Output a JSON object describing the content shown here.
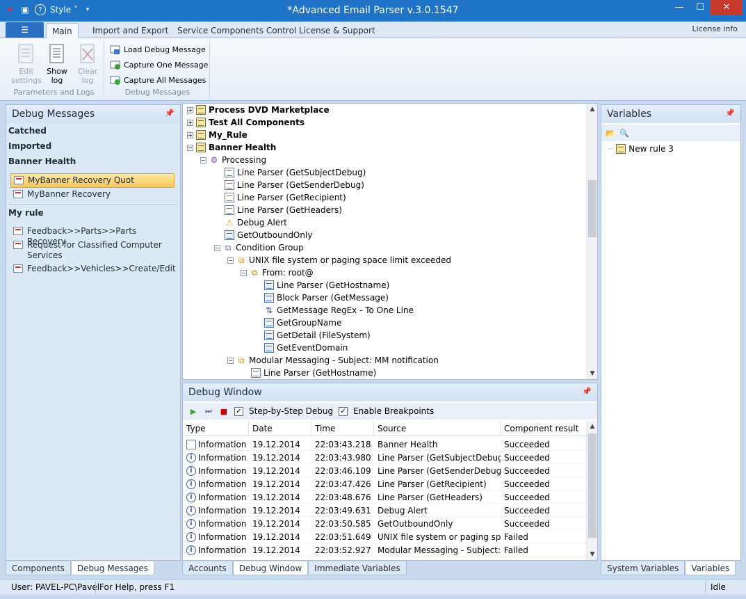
{
  "window": {
    "title": "*Advanced Email Parser v.3.0.1547",
    "style_menu": "Style",
    "minimize": "—",
    "maximize": "☐",
    "close": "✕"
  },
  "ribbon": {
    "file_tab": "☰",
    "tabs": [
      "Main",
      "Import and Export",
      "Service Components Control",
      "License & Support"
    ],
    "license_info": "License info",
    "group1": {
      "label": "Parameters and Logs",
      "buttons": [
        {
          "label": "Edit\nsettings",
          "line1": "Edit",
          "line2": "settings"
        },
        {
          "label": "Show\nlog",
          "line1": "Show",
          "line2": "log"
        },
        {
          "label": "Clear\nlog",
          "line1": "Clear",
          "line2": "log"
        }
      ]
    },
    "group2": {
      "label": "Debug Messages",
      "buttons": [
        "Load Debug Message",
        "Capture One Message",
        "Capture All Messages"
      ]
    }
  },
  "left_panel": {
    "title": "Debug Messages",
    "groups": {
      "catched": "Catched",
      "imported": "Imported",
      "banner_health": "Banner Health",
      "my_rule": "My rule"
    },
    "banner_items": [
      "MyBanner Recovery Quot",
      "MyBanner Recovery"
    ],
    "my_rule_items": [
      "Feedback>>Parts>>Parts Recovery",
      "Request for Classified Computer Services",
      "Feedback>>Vehicles>>Create/Edit"
    ],
    "bottom_tabs": [
      "Components",
      "Debug Messages"
    ]
  },
  "tree": {
    "rows": [
      "Process DVD Marketplace",
      "Test All Components",
      "My_Rule",
      "Banner Health",
      "Processing",
      "Line Parser (GetSubjectDebug)",
      "Line Parser (GetSenderDebug)",
      "Line Parser (GetRecipient)",
      "Line Parser (GetHeaders)",
      "Debug Alert",
      "GetOutboundOnly",
      "Condition Group",
      "UNIX file system or paging space limit exceeded",
      "From:  root@",
      "Line Parser (GetHostname)",
      "Block Parser (GetMessage)",
      "GetMessage RegEx - To One Line",
      "GetGroupName",
      "GetDetail (FileSystem)",
      "GetEventDomain",
      "Modular Messaging - Subject: MM notification",
      "Line Parser (GetHostname)"
    ]
  },
  "debug_window": {
    "title": "Debug Window",
    "step_by_step": "Step-by-Step Debug",
    "enable_breakpoints": "Enable Breakpoints",
    "columns": [
      "Type",
      "Date",
      "Time",
      "Source",
      "Component result"
    ],
    "rows": [
      {
        "type": "Information",
        "date": "19.12.2014",
        "time": "22:03:43.218",
        "source": "Banner Health",
        "result": "Succeeded"
      },
      {
        "type": "Information",
        "date": "19.12.2014",
        "time": "22:03:43.980",
        "source": "Line Parser (GetSubjectDebug)",
        "result": "Succeeded"
      },
      {
        "type": "Information",
        "date": "19.12.2014",
        "time": "22:03:46.109",
        "source": "Line Parser (GetSenderDebug)",
        "result": "Succeeded"
      },
      {
        "type": "Information",
        "date": "19.12.2014",
        "time": "22:03:47.426",
        "source": "Line Parser (GetRecipient)",
        "result": "Succeeded"
      },
      {
        "type": "Information",
        "date": "19.12.2014",
        "time": "22:03:48.676",
        "source": "Line Parser (GetHeaders)",
        "result": "Succeeded"
      },
      {
        "type": "Information",
        "date": "19.12.2014",
        "time": "22:03:49.631",
        "source": "Debug Alert",
        "result": "Succeeded"
      },
      {
        "type": "Information",
        "date": "19.12.2014",
        "time": "22:03:50.585",
        "source": "GetOutboundOnly",
        "result": "Succeeded"
      },
      {
        "type": "Information",
        "date": "19.12.2014",
        "time": "22:03:51.649",
        "source": "UNIX file system or paging spa...",
        "result": "Failed"
      },
      {
        "type": "Information",
        "date": "19.12.2014",
        "time": "22:03:52.927",
        "source": "Modular Messaging - Subject: ...",
        "result": "Failed"
      }
    ],
    "bottom_tabs": [
      "Accounts",
      "Debug Window",
      "Immediate Variables"
    ]
  },
  "variables": {
    "title": "Variables",
    "items": [
      "New rule 3"
    ],
    "bottom_tabs": [
      "System Variables",
      "Variables"
    ]
  },
  "status": {
    "user": "User: PAVEL-PC\\Pavel",
    "help": "For Help, press F1",
    "state": "Idle"
  },
  "colors": {
    "titlebar": "#1f74c8",
    "close": "#c7392c",
    "selected": "#f8c75c"
  }
}
